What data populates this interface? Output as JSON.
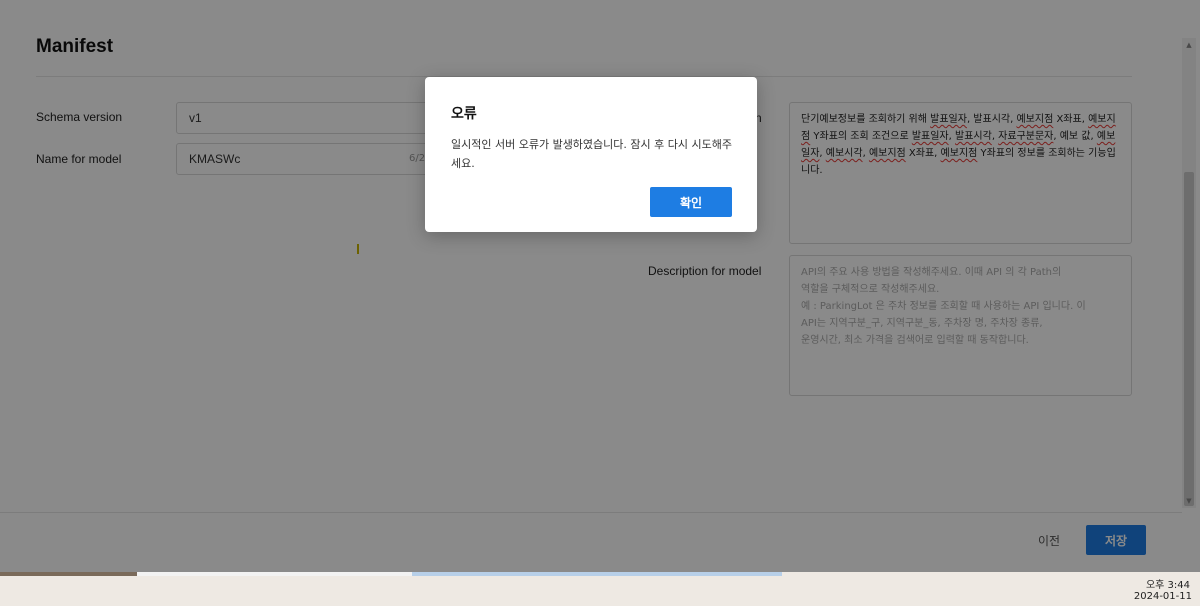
{
  "manifest": {
    "title": "Manifest",
    "fields": {
      "schema_version": {
        "label": "Schema version",
        "value": "v1"
      },
      "name_for_model": {
        "label": "Name for model",
        "value": "KMASWc",
        "count": "6/2"
      },
      "description_for_human": {
        "label_tail": "n",
        "segments": [
          {
            "text": "단기예보정보를 조회하기 위해 ",
            "squiggle": false
          },
          {
            "text": "발표일자",
            "squiggle": true
          },
          {
            "text": ", 발표시각, ",
            "squiggle": false
          },
          {
            "text": "예보지점",
            "squiggle": true
          },
          {
            "text": " X좌표, ",
            "squiggle": false
          },
          {
            "text": "예보지점",
            "squiggle": true
          },
          {
            "text": " Y좌표의 조회 조건으로 ",
            "squiggle": false
          },
          {
            "text": "발표일자",
            "squiggle": true
          },
          {
            "text": ", ",
            "squiggle": false
          },
          {
            "text": "발표시각",
            "squiggle": true
          },
          {
            "text": ", ",
            "squiggle": false
          },
          {
            "text": "자료구분문자",
            "squiggle": true
          },
          {
            "text": ", 예보 값, ",
            "squiggle": false
          },
          {
            "text": "예보일자",
            "squiggle": true
          },
          {
            "text": ", ",
            "squiggle": false
          },
          {
            "text": "예보시각",
            "squiggle": true
          },
          {
            "text": ", ",
            "squiggle": false
          },
          {
            "text": "예보지점",
            "squiggle": true
          },
          {
            "text": " X좌표, ",
            "squiggle": false
          },
          {
            "text": "예보지점",
            "squiggle": true
          },
          {
            "text": " Y좌표의 정보를 조회하는 기능입니다.",
            "squiggle": false
          }
        ]
      },
      "description_for_model": {
        "label": "Description for model",
        "placeholder": "API의 주요 사용 방법을 작성해주세요. 이때 API 의 각 Path의\n역할을 구체적으로 작성해주세요.\n예 : ParkingLot 은 주차 정보를 조회할 때 사용하는 API 입니다. 이\nAPI는 지역구분_구, 지역구분_동, 주차장 명, 주차장 종류,\n운영시간, 최소 가격을 검색어로 입력할 때 동작합니다."
      }
    },
    "footer": {
      "prev_label": "이전",
      "save_label": "저장"
    }
  },
  "dialog": {
    "title": "오류",
    "message": "일시적인 서버 오류가 발생하였습니다. 잠시 후 다시 시도해주세요.",
    "confirm_label": "확인"
  },
  "taskbar": {
    "time": "오후 3:44",
    "date": "2024-01-11"
  },
  "colors": {
    "accent": "#1e7de3",
    "overlay": "#000000"
  }
}
